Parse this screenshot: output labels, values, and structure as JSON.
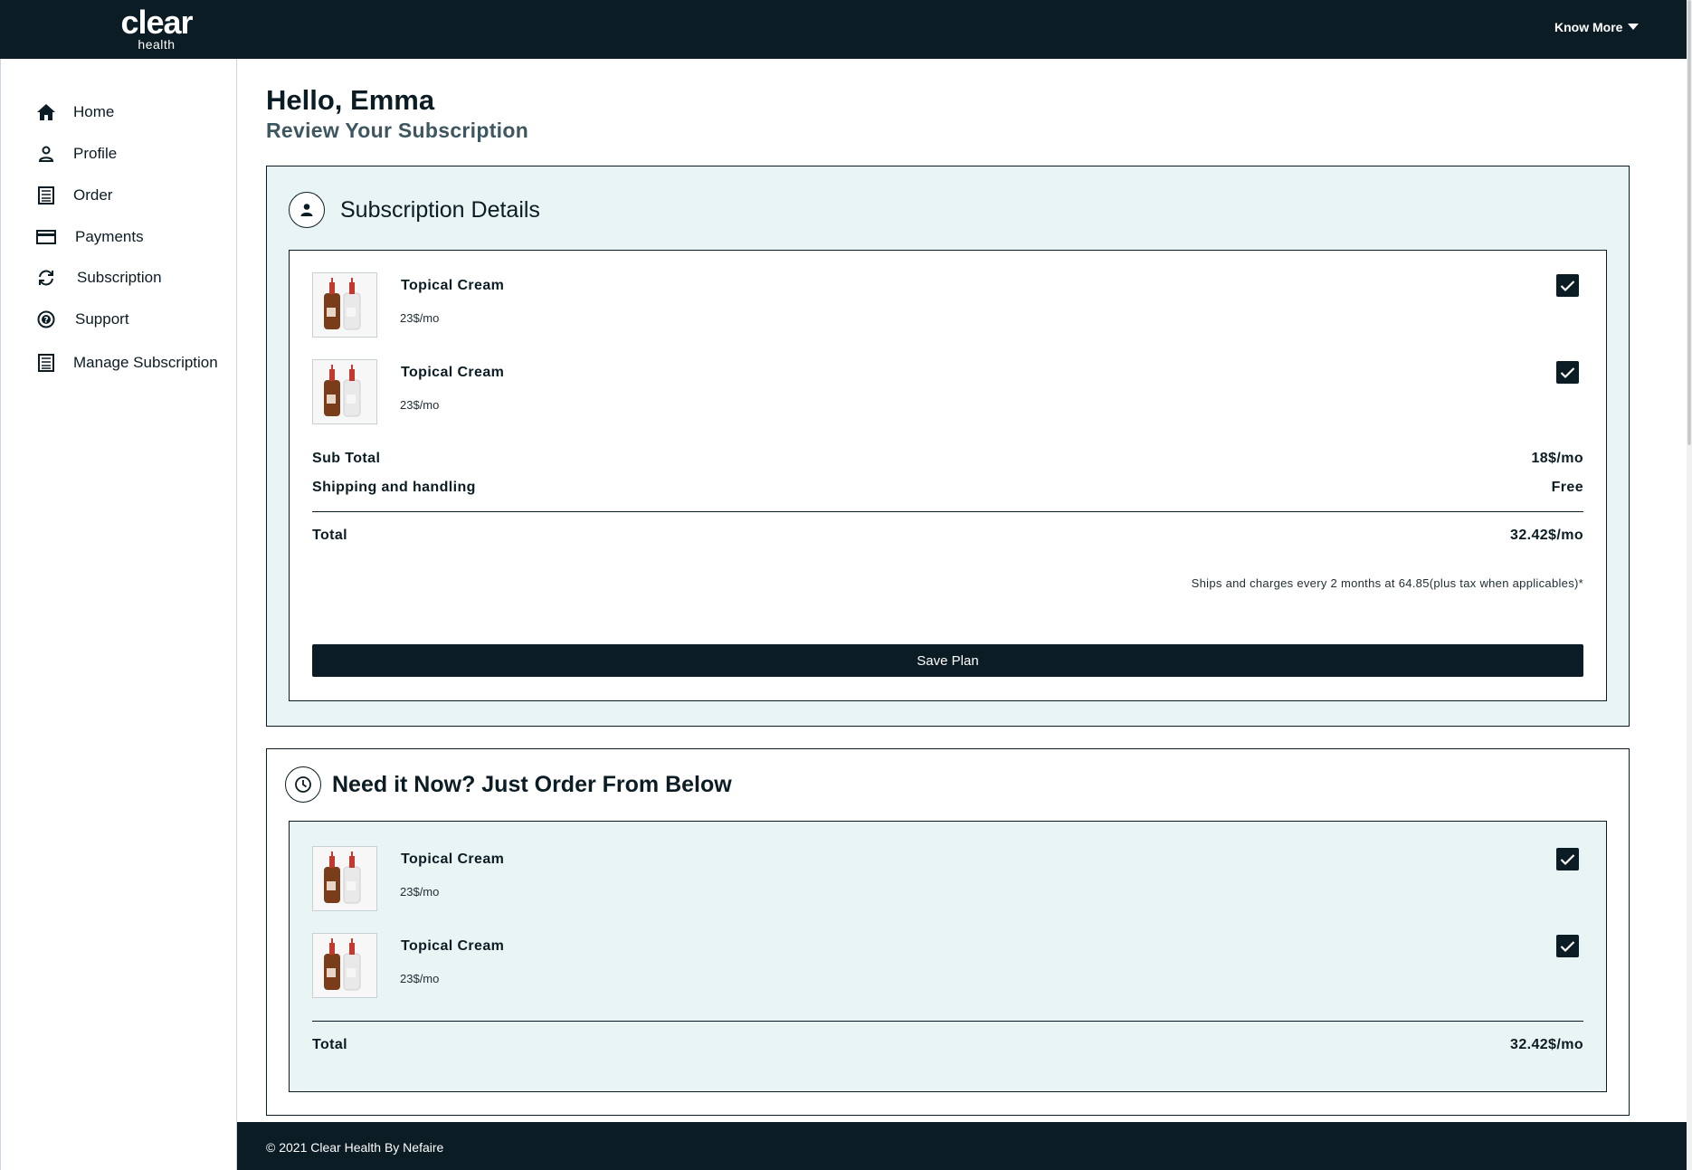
{
  "brand": {
    "logo_word": "clear",
    "logo_sub": "health"
  },
  "topbar": {
    "know_more": "Know More"
  },
  "sidebar": {
    "items": [
      {
        "label": "Home",
        "icon": "home-icon"
      },
      {
        "label": "Profile",
        "icon": "person-icon"
      },
      {
        "label": "Order",
        "icon": "list-icon"
      },
      {
        "label": "Payments",
        "icon": "credit-card-icon"
      },
      {
        "label": "Subscription",
        "icon": "refresh-icon"
      },
      {
        "label": "Support",
        "icon": "help-icon"
      },
      {
        "label": "Manage Subscription",
        "icon": "list-icon"
      }
    ]
  },
  "main": {
    "greeting": "Hello, Emma",
    "subtitle": "Review Your Subscription"
  },
  "subscription": {
    "title": "Subscription Details",
    "items": [
      {
        "name": "Topical Cream",
        "price": "23$/mo",
        "checked": true
      },
      {
        "name": "Topical Cream",
        "price": "23$/mo",
        "checked": true
      }
    ],
    "subtotal_label": "Sub Total",
    "subtotal_value": "18$/mo",
    "shipping_label": "Shipping and handling",
    "shipping_value": "Free",
    "total_label": "Total",
    "total_value": "32.42$/mo",
    "note": "Ships and charges every 2 months at 64.85(plus tax when applicables)*",
    "save_label": "Save Plan"
  },
  "order_now": {
    "title": "Need it Now? Just Order From Below",
    "items": [
      {
        "name": "Topical Cream",
        "price": "23$/mo",
        "checked": true
      },
      {
        "name": "Topical Cream",
        "price": "23$/mo",
        "checked": true
      }
    ],
    "total_label": "Total",
    "total_value": "32.42$/mo"
  },
  "footer": {
    "copyright": "© 2021 Clear Health By Nefaire"
  },
  "colors": {
    "dark": "#0b1c24",
    "panel_tint": "#e9f4f4",
    "subtitle": "#3e5660"
  }
}
